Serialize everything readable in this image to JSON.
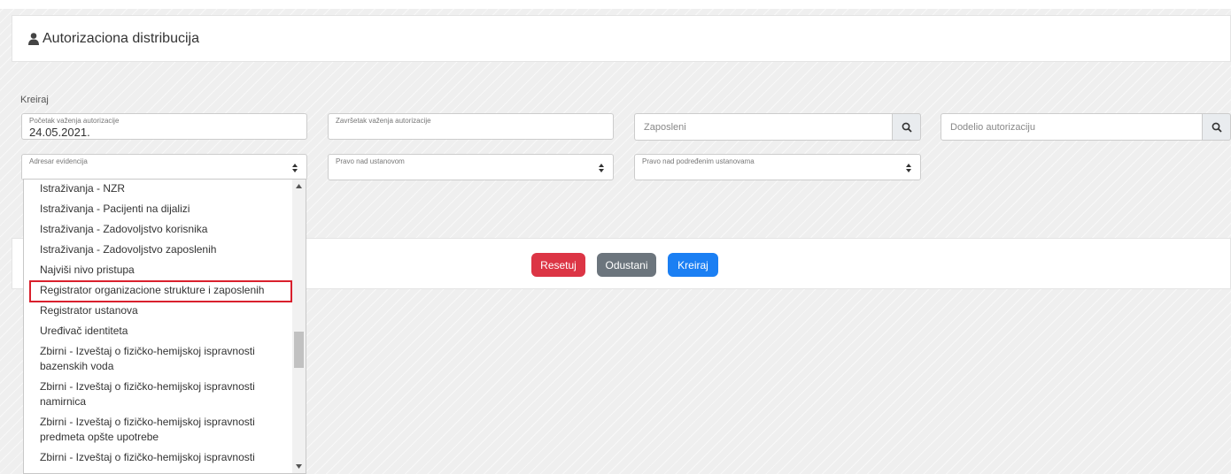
{
  "header": {
    "title": "Autorizaciona distribucija",
    "icon": "user-icon"
  },
  "form": {
    "section_label": "Kreiraj",
    "start_date": {
      "label": "Početak važenja autorizacije",
      "value": "24.05.2021."
    },
    "end_date": {
      "label": "Završetak važenja autorizacije",
      "value": ""
    },
    "employees": {
      "placeholder": "Zaposleni"
    },
    "granted_by": {
      "placeholder": "Dodelio autorizaciju"
    },
    "registry": {
      "label": "Adresar evidencija"
    },
    "institution_right": {
      "label": "Pravo nad ustanovom"
    },
    "sub_institution_right": {
      "label": "Pravo nad podređenim ustanovama"
    }
  },
  "actions": {
    "reset": "Resetuj",
    "cancel": "Odustani",
    "create": "Kreiraj"
  },
  "colors": {
    "reset": "#dc3545",
    "cancel": "#6c757d",
    "create": "#1b7ff3",
    "highlight": "#d9202d"
  },
  "dropdown": {
    "items": [
      "Istraživanja - NZR",
      "Istraživanja - Pacijenti na dijalizi",
      "Istraživanja - Zadovoljstvo korisnika",
      "Istraživanja - Zadovoljstvo zaposlenih",
      "Najviši nivo pristupa",
      "Registrator organizacione strukture i zaposlenih",
      "Registrator ustanova",
      "Uređivač identiteta",
      "Zbirni - Izveštaj o fizičko-hemijskoj ispravnosti bazenskih voda",
      "Zbirni - Izveštaj o fizičko-hemijskoj ispravnosti namirnica",
      "Zbirni - Izveštaj o fizičko-hemijskoj ispravnosti predmeta opšte upotrebe",
      "Zbirni - Izveštaj o fizičko-hemijskoj ispravnosti"
    ],
    "highlighted": "Registrator organizacione strukture i zaposlenih"
  }
}
